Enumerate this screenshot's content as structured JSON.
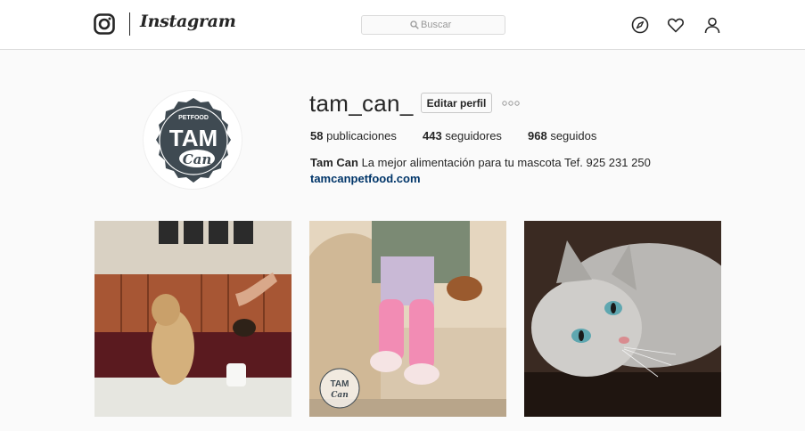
{
  "header": {
    "logo_text": "Instagram",
    "search_placeholder": "Buscar",
    "icons": [
      "instagram-glyph-icon",
      "search-icon",
      "explore-compass-icon",
      "heart-icon",
      "profile-icon"
    ]
  },
  "profile": {
    "username": "tam_can_",
    "edit_label": "Editar perfil",
    "stats": [
      {
        "count": "58",
        "label": "publicaciones"
      },
      {
        "count": "443",
        "label": "seguidores"
      },
      {
        "count": "968",
        "label": "seguidos"
      }
    ],
    "display_name": "Tam Can",
    "bio": "La mejor alimentación para tu mascota Tef. 925 231 250",
    "website": "tamcanpetfood.com",
    "avatar_logo": {
      "top": "PETFOOD",
      "main": "TAM",
      "script": "Can"
    }
  },
  "posts": [
    {
      "name": "dog-coffee-photo"
    },
    {
      "name": "child-puppy-sofa-photo",
      "watermark": {
        "main": "TAM",
        "script": "Can"
      }
    },
    {
      "name": "grey-cat-photo"
    }
  ],
  "colors": {
    "accent_link": "#003569",
    "border": "#dbdbdb",
    "text": "#262626",
    "background": "#fafafa"
  }
}
